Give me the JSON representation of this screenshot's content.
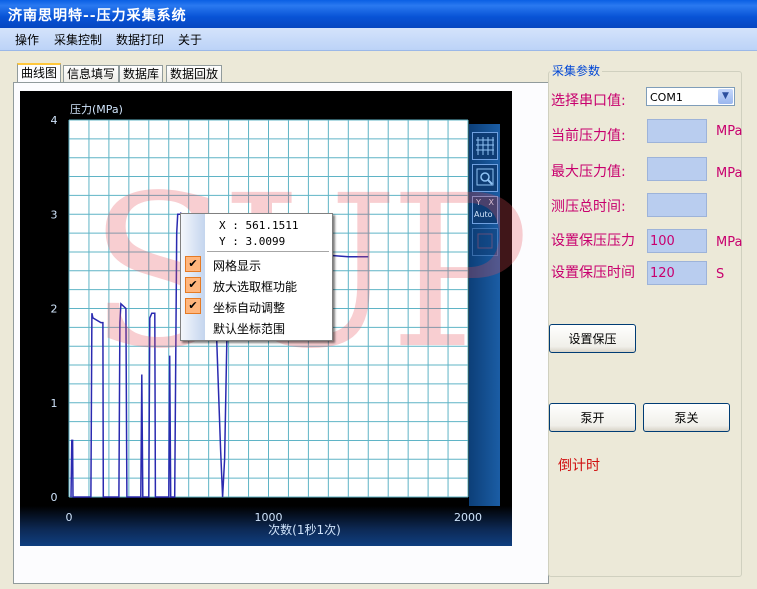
{
  "window": {
    "title": "济南思明特--压力采集系统"
  },
  "menu": [
    "操作",
    "采集控制",
    "数据打印",
    "关于"
  ],
  "tabs": [
    {
      "label": "曲线图",
      "active": true
    },
    {
      "label": "信息填写",
      "active": false
    },
    {
      "label": "数据库",
      "active": false
    },
    {
      "label": "数据回放",
      "active": false
    }
  ],
  "chart": {
    "ylabel": "压力(MPa)",
    "xlabel": "次数(1秒1次)",
    "y_ticks": [
      "0",
      "1",
      "2",
      "3",
      "4"
    ],
    "x_ticks": [
      "0",
      "1000",
      "2000"
    ],
    "toolbar": {
      "grid_icon": "grid-icon",
      "zoom_icon": "zoom-icon",
      "auto_label_y": "Y",
      "auto_label_x": "X",
      "auto_label": "Auto"
    },
    "colors": {
      "grid": "#5fb4c6",
      "line": "#2a2ab0",
      "background": "#ffffff",
      "frame": "#000000"
    }
  },
  "chart_data": {
    "type": "line",
    "xlim": [
      0,
      2000
    ],
    "ylim": [
      0,
      4
    ],
    "grid": true,
    "series": [
      {
        "values_xy": [
          [
            10,
            0
          ],
          [
            14,
            0.6
          ],
          [
            18,
            0.6
          ],
          [
            20,
            0
          ],
          [
            110,
            0
          ],
          [
            115,
            1.95
          ],
          [
            120,
            1.9
          ],
          [
            160,
            1.85
          ],
          [
            170,
            1.85
          ],
          [
            172,
            0
          ],
          [
            250,
            0
          ],
          [
            255,
            1.85
          ],
          [
            260,
            2.05
          ],
          [
            285,
            2.0
          ],
          [
            290,
            0
          ],
          [
            360,
            0
          ],
          [
            365,
            1.3
          ],
          [
            370,
            0
          ],
          [
            400,
            0
          ],
          [
            405,
            1.9
          ],
          [
            415,
            1.95
          ],
          [
            430,
            1.95
          ],
          [
            433,
            0
          ],
          [
            500,
            0
          ],
          [
            505,
            1.5
          ],
          [
            510,
            0
          ],
          [
            530,
            0
          ],
          [
            540,
            2.8
          ],
          [
            545,
            3.0
          ],
          [
            560,
            3.0
          ],
          [
            561,
            3.0099
          ],
          [
            580,
            2.98
          ],
          [
            600,
            2.95
          ],
          [
            660,
            2.9
          ],
          [
            705,
            2.9
          ],
          [
            715,
            2.85
          ],
          [
            720,
            2.9
          ],
          [
            760,
            0.5
          ],
          [
            770,
            0
          ],
          [
            780,
            0.4
          ],
          [
            800,
            2.65
          ],
          [
            1000,
            2.62
          ],
          [
            1200,
            2.58
          ],
          [
            1400,
            2.55
          ],
          [
            1500,
            2.55
          ]
        ]
      }
    ]
  },
  "context_menu": {
    "x_readout": "X : 561.1511",
    "y_readout": "Y : 3.0099",
    "items": [
      {
        "label": "网格显示",
        "checked": true
      },
      {
        "label": "放大选取框功能",
        "checked": true
      },
      {
        "label": "坐标自动调整",
        "checked": true
      },
      {
        "label": "默认坐标范围",
        "checked": false
      }
    ]
  },
  "params": {
    "group_title": "采集参数",
    "port_label": "选择串口值:",
    "port_value": "COM1",
    "current_pressure_label": "当前压力值:",
    "current_pressure_value": "",
    "max_pressure_label": "最大压力值:",
    "max_pressure_value": "",
    "total_time_label": "测压总时间:",
    "total_time_value": "",
    "hold_pressure_label": "设置保压压力",
    "hold_pressure_value": "100",
    "hold_time_label": "设置保压时间",
    "hold_time_value": "120",
    "unit_mpa": "MPa",
    "unit_s": "S",
    "set_hold_button": "设置保压",
    "pump_on_button": "泵开",
    "pump_off_button": "泵关",
    "countdown_label": "倒计时"
  },
  "watermark": "SUP"
}
